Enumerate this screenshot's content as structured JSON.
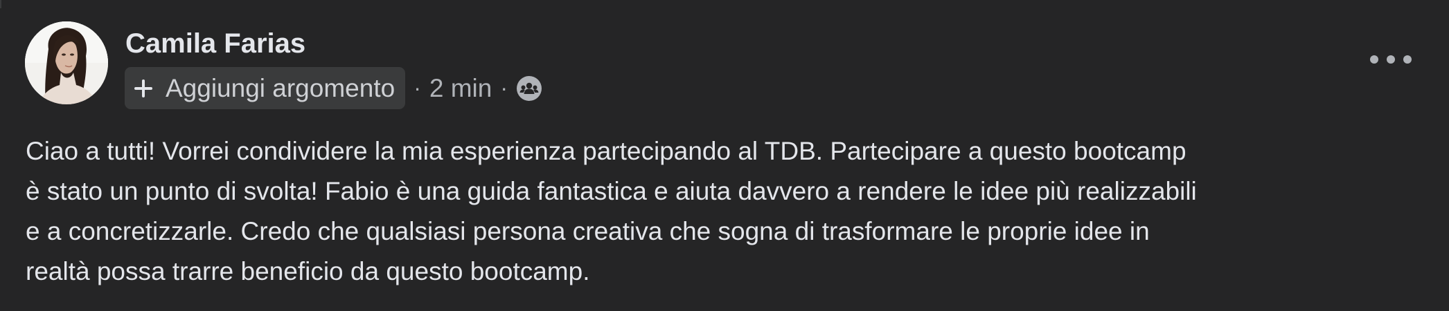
{
  "post": {
    "author": {
      "name": "Camila Farias",
      "avatar_icon": "profile-photo"
    },
    "meta": {
      "topic_button_label": "Aggiungi argomento",
      "separator": "·",
      "time_ago": "2 min",
      "audience_icon": "group-audience-icon"
    },
    "more_options_icon": "more-horizontal-icon",
    "body_lines": [
      "Ciao a tutti! Vorrei condividere la mia esperienza partecipando al TDB. Partecipare a questo bootcamp",
      "è stato un punto di svolta! Fabio è una guida fantastica e aiuta davvero a rendere le idee più realizzabili",
      "e a concretizzarle. Credo che qualsiasi persona creativa che sogna di trasformare le proprie idee in",
      "realtà possa trarre beneficio da questo bootcamp."
    ]
  },
  "colors": {
    "background": "#252526",
    "text_primary": "#e4e6eb",
    "text_secondary": "#b0b3b8",
    "chip_background": "#3a3b3c"
  }
}
